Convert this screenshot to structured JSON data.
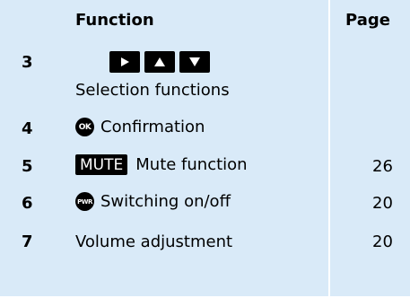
{
  "header": {
    "function": "Function",
    "page": "Page"
  },
  "rows": [
    {
      "num": "3",
      "label": "Selection functions",
      "page": ""
    },
    {
      "num": "4",
      "label": "Confirmation",
      "icon_text": "OK",
      "page": ""
    },
    {
      "num": "5",
      "label": "Mute function",
      "key_text": "MUTE",
      "page": "26"
    },
    {
      "num": "6",
      "label": "Switching on/off",
      "icon_text": "PWR",
      "page": "20"
    },
    {
      "num": "7",
      "label": "Volume adjustment",
      "page": "20"
    }
  ],
  "icons": {
    "right": "play-right-icon",
    "up": "arrow-up-icon",
    "down": "arrow-down-icon",
    "ok": "ok-button-icon",
    "mute": "mute-button-icon",
    "power": "power-button-icon"
  },
  "colors": {
    "background": "#d9eaf8",
    "key": "#000000",
    "text": "#000000"
  }
}
